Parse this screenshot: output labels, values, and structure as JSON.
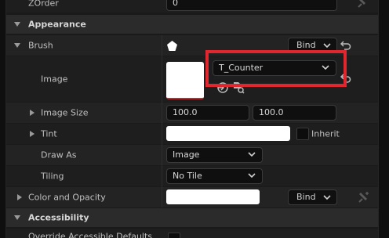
{
  "rows": {
    "zorder": {
      "label": "ZOrder",
      "value": "0"
    },
    "appearance": {
      "label": "Appearance"
    },
    "brush": {
      "label": "Brush",
      "bind": "Bind"
    },
    "image": {
      "label": "Image",
      "asset": "T_Counter"
    },
    "image_size": {
      "label": "Image Size",
      "x": "100.0",
      "y": "100.0"
    },
    "tint": {
      "label": "Tint",
      "inherit": "Inherit"
    },
    "draw_as": {
      "label": "Draw As",
      "value": "Image"
    },
    "tiling": {
      "label": "Tiling",
      "value": "No Tile"
    },
    "color_opacity": {
      "label": "Color and Opacity",
      "bind": "Bind"
    },
    "accessibility": {
      "label": "Accessibility"
    },
    "override_access": {
      "label": "Override Accessible Defaults"
    }
  },
  "colors": {
    "highlight": "#e0262e",
    "swatch": "#ffffff"
  },
  "icons": [
    "chevron-down-icon",
    "chevron-right-icon",
    "reset-arrow-icon",
    "pin-icon",
    "pentagon-icon",
    "use-selected-icon",
    "browse-icon"
  ]
}
